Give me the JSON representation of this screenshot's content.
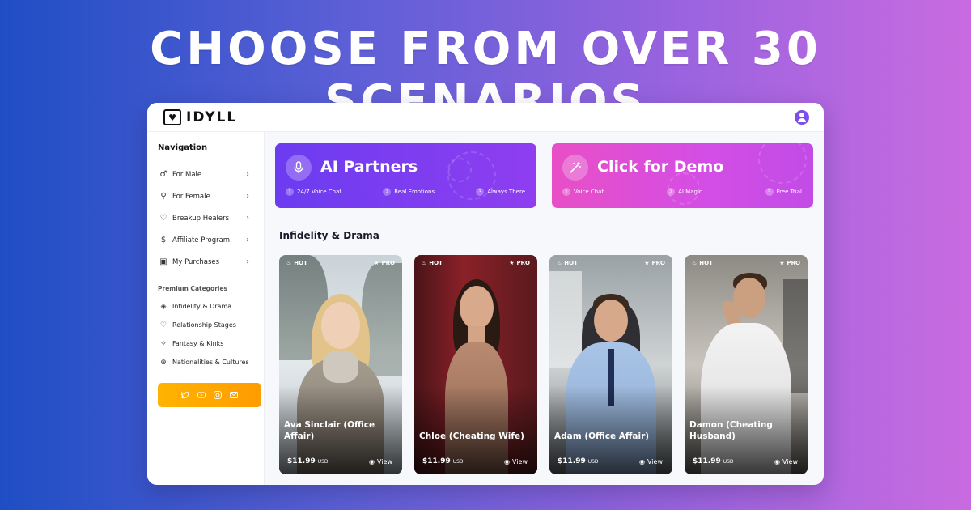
{
  "headline": "Choose from over 30 scenarios",
  "app": {
    "logo_text": "IDYLL"
  },
  "sidebar": {
    "nav_title": "Navigation",
    "items": [
      {
        "icon": "male-icon",
        "label": "For Male"
      },
      {
        "icon": "female-icon",
        "label": "For Female"
      },
      {
        "icon": "heart-icon",
        "label": "Breakup Healers"
      },
      {
        "icon": "dollar-icon",
        "label": "Affiliate Program"
      },
      {
        "icon": "bag-icon",
        "label": "My Purchases"
      }
    ],
    "premium_title": "Premium Categories",
    "categories": [
      {
        "icon": "tag-icon",
        "label": "Infidelity & Drama"
      },
      {
        "icon": "heart-outline-icon",
        "label": "Relationship Stages"
      },
      {
        "icon": "sparkle-icon",
        "label": "Fantasy & Kinks"
      },
      {
        "icon": "globe-icon",
        "label": "Nationalities & Cultures"
      }
    ],
    "social_icons": [
      "twitter-icon",
      "youtube-icon",
      "instagram-icon",
      "mail-icon"
    ],
    "social_color": "#ffa800"
  },
  "banners": [
    {
      "title": "AI Partners",
      "icon": "microphone-icon",
      "features": [
        "24/7 Voice Chat",
        "Real Emotions",
        "Always There"
      ],
      "color": "#7a3cf0"
    },
    {
      "title": "Click for Demo",
      "icon": "magic-wand-icon",
      "features": [
        "Voice Chat",
        "AI Magic",
        "Free Trial"
      ],
      "color": "#d94ee0"
    }
  ],
  "section_title": "Infidelity & Drama",
  "cards": [
    {
      "name": "Ava Sinclair (Office Affair)",
      "price": "$11.99",
      "currency": "USD",
      "hot": "HOT",
      "pro": "PRO",
      "view": "View"
    },
    {
      "name": "Chloe (Cheating Wife)",
      "price": "$11.99",
      "currency": "USD",
      "hot": "HOT",
      "pro": "PRO",
      "view": "View"
    },
    {
      "name": "Adam (Office Affair)",
      "price": "$11.99",
      "currency": "USD",
      "hot": "HOT",
      "pro": "PRO",
      "view": "View"
    },
    {
      "name": "Damon (Cheating Husband)",
      "price": "$11.99",
      "currency": "USD",
      "hot": "HOT",
      "pro": "PRO",
      "view": "View"
    }
  ]
}
